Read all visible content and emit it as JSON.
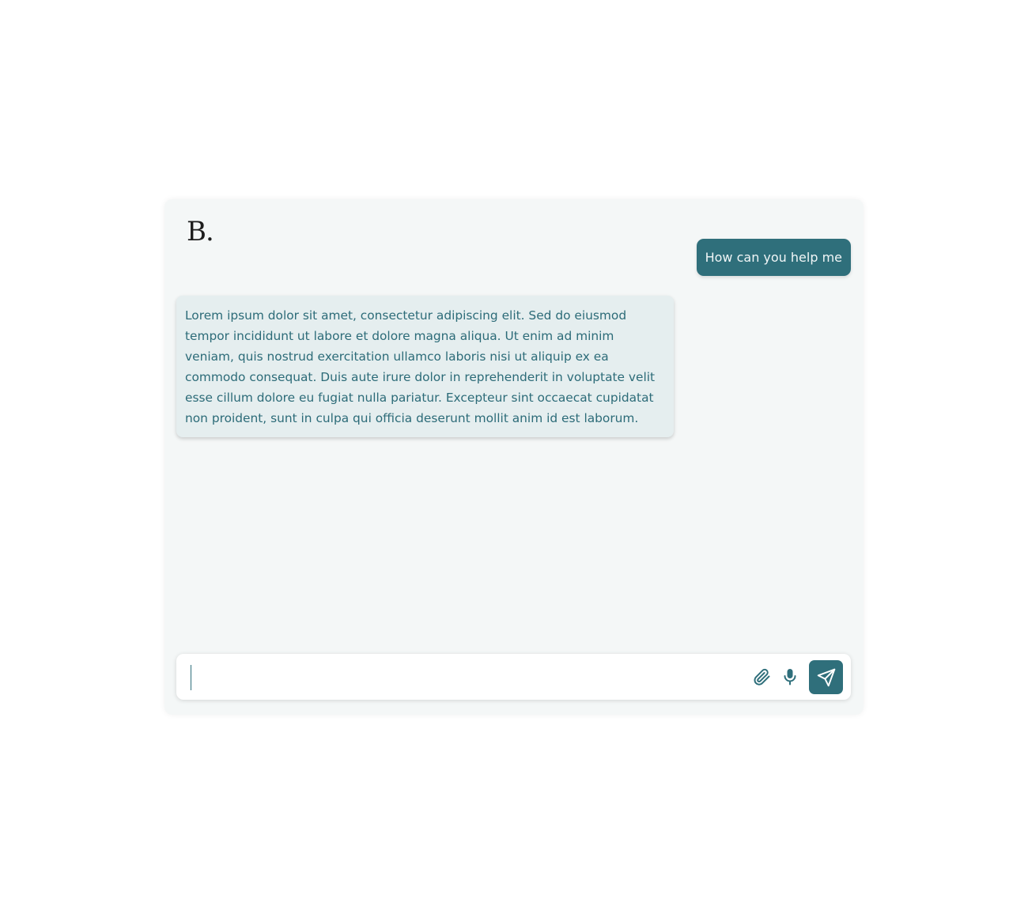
{
  "brand": {
    "logo_text": "B."
  },
  "conversation": {
    "user_message": "How can you help me",
    "bot_message": "Lorem ipsum dolor sit amet, consectetur adipiscing elit. Sed do eiusmod tempor incididunt ut labore et dolore magna aliqua. Ut enim ad minim veniam, quis nostrud exercitation ullamco laboris nisi ut aliquip ex ea commodo consequat. Duis aute irure dolor in reprehenderit in voluptate velit esse cillum dolore eu fugiat nulla pariatur. Excepteur sint occaecat cupidatat non proident, sunt in culpa qui officia deserunt mollit anim id est laborum."
  },
  "composer": {
    "value": "",
    "icons": {
      "attach": "paperclip-icon",
      "mic": "microphone-icon",
      "send": "send-icon"
    }
  },
  "colors": {
    "accent": "#2f6f7b",
    "bot_bubble_bg": "#e5eeef",
    "bot_text": "#2c6b78",
    "window_bg": "#f4f7f7"
  }
}
